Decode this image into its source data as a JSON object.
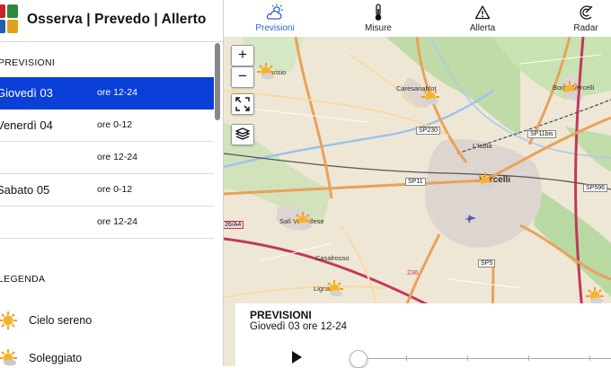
{
  "app": {
    "title": "Osserva | Prevedo | Allerto"
  },
  "nav": {
    "tabs": [
      {
        "label": "Previsioni",
        "icon": "cloud-sun-icon",
        "active": true
      },
      {
        "label": "Misure",
        "icon": "thermometer-icon",
        "active": false
      },
      {
        "label": "Allerta",
        "icon": "warning-triangle-icon",
        "active": false
      },
      {
        "label": "Radar",
        "icon": "radar-icon",
        "active": false
      }
    ],
    "active_color": "#2a64c8"
  },
  "sidebar": {
    "forecast_heading": "PREVISIONI",
    "rows": [
      {
        "day": "Giovedì 03",
        "slot": "ore 12-24",
        "selected": true
      },
      {
        "day": "Venerdì 04",
        "slot": "ore 0-12",
        "selected": false
      },
      {
        "day": "",
        "slot": "ore 12-24",
        "selected": false
      },
      {
        "day": "Sabato 05",
        "slot": "ore 0-12",
        "selected": false
      },
      {
        "day": "",
        "slot": "ore 12-24",
        "selected": false
      }
    ],
    "legend_heading": "LEGENDA",
    "legend": [
      {
        "label": "Cielo sereno",
        "icon": "sun-icon"
      },
      {
        "label": "Soleggiato",
        "icon": "sun-cloud-icon"
      }
    ],
    "selected_color": "#0a3fd8"
  },
  "map": {
    "controls": {
      "zoom_in": "+",
      "zoom_out": "−"
    },
    "places": [
      "Carisio",
      "Caresanablot",
      "Borgo Vercelli",
      "L'Isola",
      "Vercelli",
      "Salì Vercellese",
      "Casalrosso",
      "Lignana"
    ],
    "road_labels": [
      "SP230",
      "SP11bis",
      "SP11",
      "SP596",
      "26/A4",
      "SP5",
      "236"
    ]
  },
  "forecast_panel": {
    "title": "PREVISIONI",
    "subtitle": "Giovedì 03 ore 12-24"
  }
}
